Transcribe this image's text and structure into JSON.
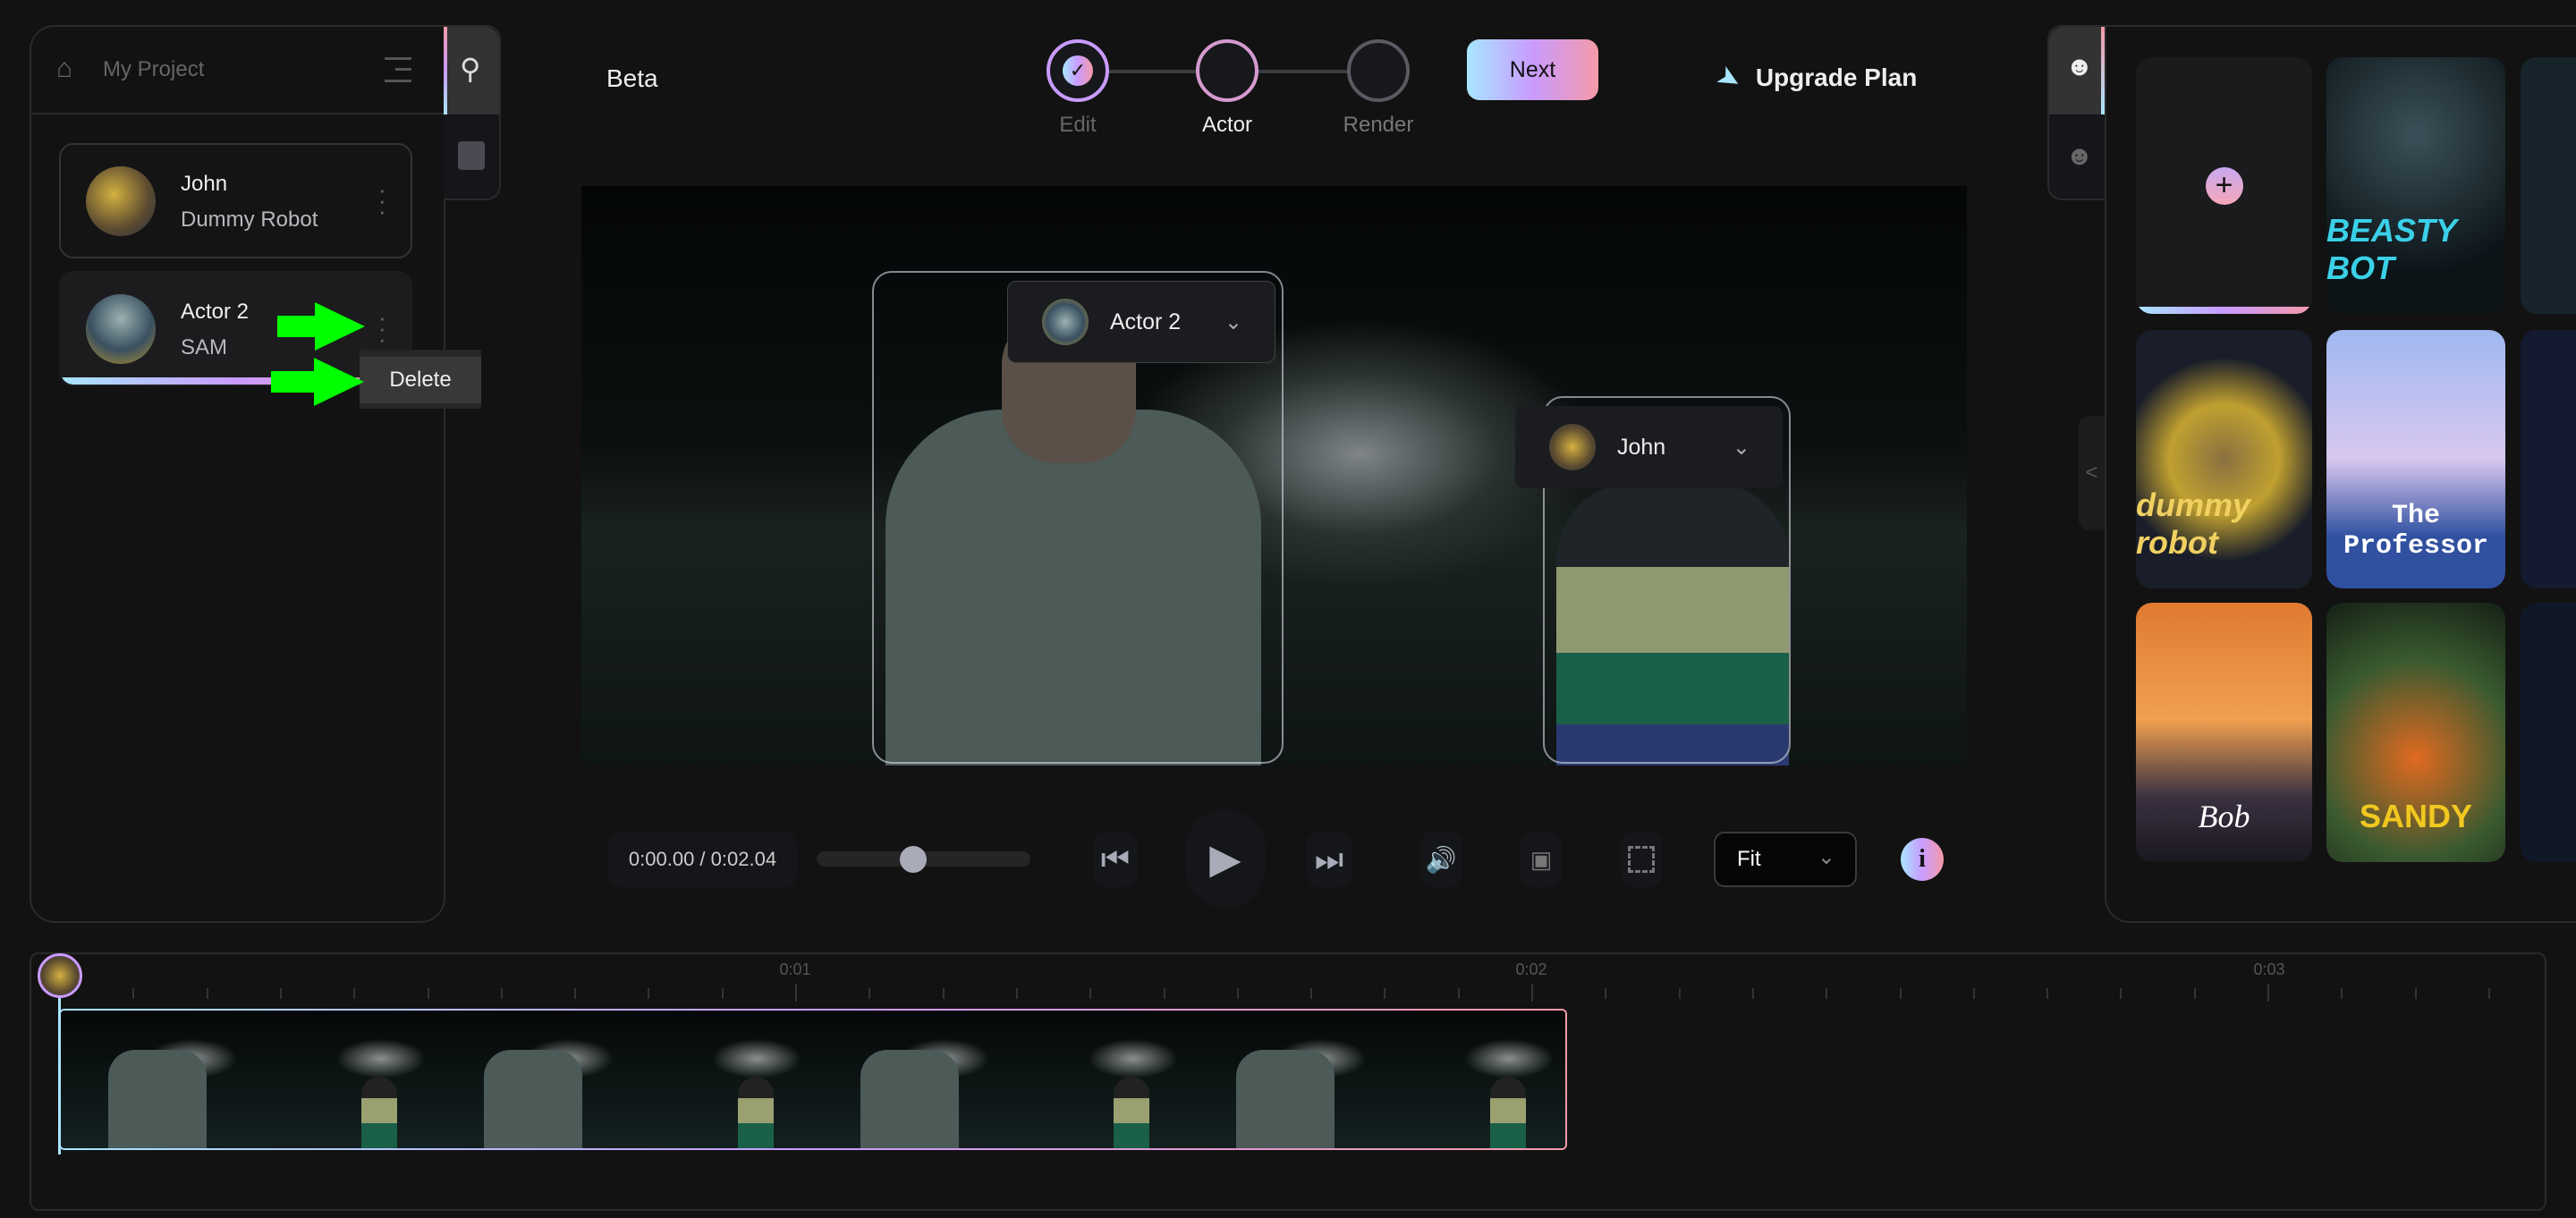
{
  "left_panel": {
    "project_title": "My Project",
    "actors": [
      {
        "name": "John",
        "character": "Dummy Robot",
        "selected": false
      },
      {
        "name": "Actor 2",
        "character": "SAM",
        "selected": true
      }
    ],
    "context_menu": {
      "delete_label": "Delete"
    }
  },
  "header": {
    "title": "Beta",
    "steps": [
      {
        "label": "Edit",
        "state": "done"
      },
      {
        "label": "Actor",
        "state": "current"
      },
      {
        "label": "Render",
        "state": "pending"
      }
    ],
    "next_label": "Next",
    "upgrade_label": "Upgrade Plan"
  },
  "video": {
    "face_labels": [
      {
        "actor": "Actor 2"
      },
      {
        "actor": "John"
      }
    ]
  },
  "controls": {
    "time": "0:00.00 / 0:02.04",
    "progress_percent": 45,
    "zoom_select": "Fit"
  },
  "right_panel": {
    "characters": [
      "BEASTY BOT",
      "dummy robot",
      "The Professor",
      "Bob",
      "SANDY"
    ]
  },
  "timeline": {
    "ticks": [
      "0:01",
      "0:02",
      "0:03"
    ]
  },
  "colors": {
    "accent_gradient": [
      "#a8e6ff",
      "#c99bff",
      "#f59aa8"
    ],
    "annotation_arrow": "#00ff00",
    "background": "#121212"
  }
}
